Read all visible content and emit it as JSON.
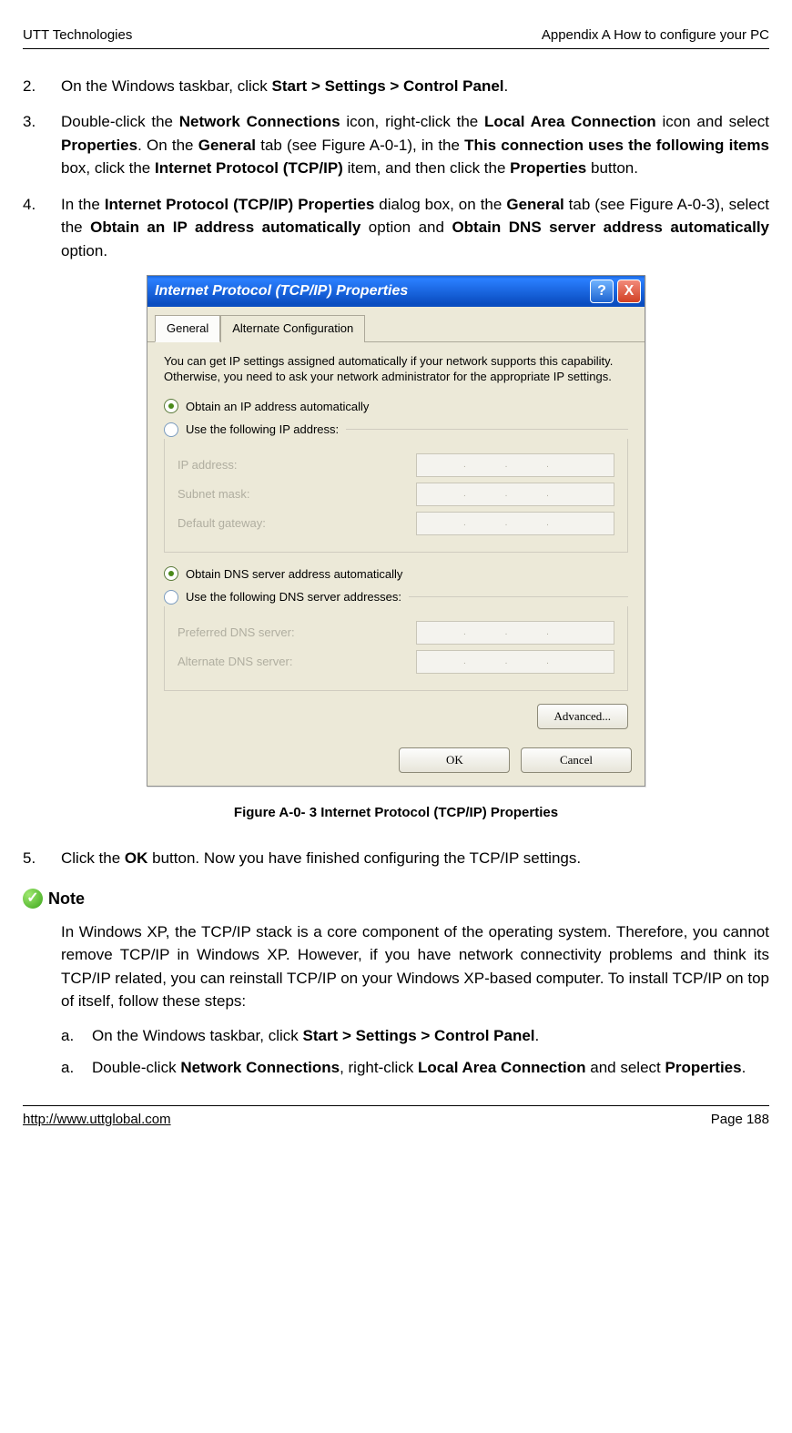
{
  "header": {
    "left": "UTT Technologies",
    "right": "Appendix A How to configure your PC"
  },
  "steps": {
    "s2": {
      "num": "2.",
      "pre": "On the Windows taskbar, click ",
      "bold": "Start > Settings > Control Panel",
      "post": "."
    },
    "s3": {
      "num": "3.",
      "t1": "Double-click the ",
      "b1": "Network Connections",
      "t2": " icon, right-click the ",
      "b2": "Local Area Connection",
      "t3": " icon and select ",
      "b3": "Properties",
      "t4": ". On the ",
      "b4": "General",
      "t5": " tab (see Figure A-0-1), in the ",
      "b5": "This connection uses the following items",
      "t6": " box, click the ",
      "b6": "Internet Protocol (TCP/IP)",
      "t7": " item, and then click the ",
      "b7": "Properties",
      "t8": " button."
    },
    "s4": {
      "num": "4.",
      "t1": "In the ",
      "b1": "Internet Protocol (TCP/IP) Properties",
      "t2": " dialog box, on the ",
      "b2": "General",
      "t3": " tab (see Figure A-0-3), select the ",
      "b3": "Obtain an IP address automatically",
      "t4": " option and ",
      "b4": "Obtain DNS server address automatically",
      "t5": " option."
    },
    "s5": {
      "num": "5.",
      "t1": "Click the ",
      "b1": "OK",
      "t2": " button. Now you have finished configuring the TCP/IP settings."
    }
  },
  "dialog": {
    "title": "Internet Protocol (TCP/IP) Properties",
    "help": "?",
    "close": "X",
    "tabs": {
      "general": "General",
      "alt": "Alternate Configuration"
    },
    "desc": "You can get IP settings assigned automatically if your network supports this capability. Otherwise, you need to ask your network administrator for the appropriate IP settings.",
    "r_ip_auto": "Obtain an IP address automatically",
    "r_ip_manual": "Use the following IP address:",
    "f_ip": "IP address:",
    "f_mask": "Subnet mask:",
    "f_gw": "Default gateway:",
    "r_dns_auto": "Obtain DNS server address automatically",
    "r_dns_manual": "Use the following DNS server addresses:",
    "f_pdns": "Preferred DNS server:",
    "f_adns": "Alternate DNS server:",
    "btn_adv": "Advanced...",
    "btn_ok": "OK",
    "btn_cancel": "Cancel",
    "ip_dots": ".  .  ."
  },
  "figcap": "Figure A-0- 3 Internet Protocol (TCP/IP) Properties",
  "note": {
    "label": "Note",
    "icon": "✓",
    "body": "In Windows XP, the TCP/IP stack is a core component of the operating system. Therefore, you cannot remove TCP/IP in Windows XP. However, if you have network connectivity problems and think its TCP/IP related, you can reinstall TCP/IP on your Windows XP-based computer. To install TCP/IP on top of itself, follow these steps:",
    "a1": {
      "num": "a.",
      "t1": "On the Windows taskbar, click ",
      "b1": "Start > Settings > Control Panel",
      "t2": "."
    },
    "a2": {
      "num": "a.",
      "t1": "Double-click ",
      "b1": "Network Connections",
      "t2": ", right-click ",
      "b2": "Local Area Connection",
      "t3": " and select ",
      "b3": "Properties",
      "t4": "."
    }
  },
  "footer": {
    "url": "http://www.uttglobal.com",
    "page": "Page 188"
  }
}
